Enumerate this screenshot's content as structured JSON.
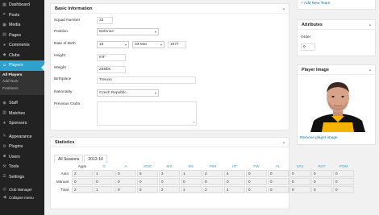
{
  "sidebar": {
    "items": [
      {
        "label": "Dashboard",
        "icon": "dashboard-icon",
        "glyph": "▦"
      },
      {
        "label": "Posts",
        "icon": "pin-icon",
        "glyph": "✒"
      },
      {
        "label": "Media",
        "icon": "media-icon",
        "glyph": "▣"
      },
      {
        "label": "Pages",
        "icon": "pages-icon",
        "glyph": "▤"
      },
      {
        "label": "Comments",
        "icon": "comments-icon",
        "glyph": "●"
      },
      {
        "label": "Clubs",
        "icon": "shield-icon",
        "glyph": "◆"
      },
      {
        "label": "Players",
        "icon": "user-icon",
        "glyph": "☺"
      }
    ],
    "players_sub": [
      "All Players",
      "Add New",
      "Positions"
    ],
    "items2": [
      {
        "label": "Staff",
        "icon": "staff-icon",
        "glyph": "◉"
      },
      {
        "label": "Matches",
        "icon": "calendar-icon",
        "glyph": "▥"
      },
      {
        "label": "Sponsors",
        "icon": "star-icon",
        "glyph": "★"
      }
    ],
    "items3": [
      {
        "label": "Appearance",
        "icon": "brush-icon",
        "glyph": "✎"
      },
      {
        "label": "Plugins",
        "icon": "plugin-icon",
        "glyph": "⚙"
      },
      {
        "label": "Users",
        "icon": "users-icon",
        "glyph": "☻"
      },
      {
        "label": "Tools",
        "icon": "wrench-icon",
        "glyph": "⚒"
      },
      {
        "label": "Settings",
        "icon": "settings-icon",
        "glyph": "☰"
      }
    ],
    "items4": [
      {
        "label": "Club Manager",
        "icon": "club-manager-icon",
        "glyph": "◎"
      },
      {
        "label": "Collapse menu",
        "icon": "collapse-icon",
        "glyph": "◀"
      }
    ]
  },
  "basic": {
    "title": "Basic Information",
    "squad_label": "Squad Number",
    "squad_value": "33",
    "position_label": "Position",
    "position_value": "Defense",
    "dob_label": "Date of Birth",
    "dob_day": "18",
    "dob_month": "03-Mar",
    "dob_year": "1977",
    "height_label": "Height",
    "height_value": "6'9\"",
    "weight_label": "Weight",
    "weight_value": "255lbs",
    "birthplace_label": "Birthplace",
    "birthplace_value": "Trencin",
    "nationality_label": "Nationality",
    "nationality_value": "Czech Republic",
    "prev_clubs_label": "Previous Clubs"
  },
  "stats": {
    "title": "Statistics",
    "tabs": [
      "All Seasons",
      "2013-14"
    ],
    "columns": [
      "Apps",
      "G",
      "A",
      "SOG",
      "MS",
      "BS",
      "PIM",
      "HT",
      "FW",
      "FL",
      "SAV",
      "RAT",
      "POM"
    ],
    "rows": [
      {
        "label": "Auto",
        "values": [
          "2",
          "1",
          "0",
          "5",
          "2",
          "1",
          "2",
          "4",
          "0",
          "0",
          "0",
          "0",
          "0"
        ]
      },
      {
        "label": "Manual",
        "values": [
          "0",
          "0",
          "0",
          "0",
          "0",
          "0",
          "0",
          "0",
          "0",
          "0",
          "0",
          "0",
          "0"
        ]
      },
      {
        "label": "Total",
        "values": [
          "2",
          "1",
          "0",
          "5",
          "2",
          "1",
          "2",
          "4",
          "0",
          "0",
          "0",
          "0",
          "0"
        ]
      }
    ]
  },
  "right": {
    "add_new_team": "+ Add New Team",
    "attributes_title": "Attributes",
    "order_label": "Order",
    "order_value": "0",
    "player_image_title": "Player Image",
    "remove_image": "Remove player image"
  },
  "colors": {
    "accent": "#2ea2cc",
    "sidebar": "#222222",
    "link": "#0074a2"
  }
}
